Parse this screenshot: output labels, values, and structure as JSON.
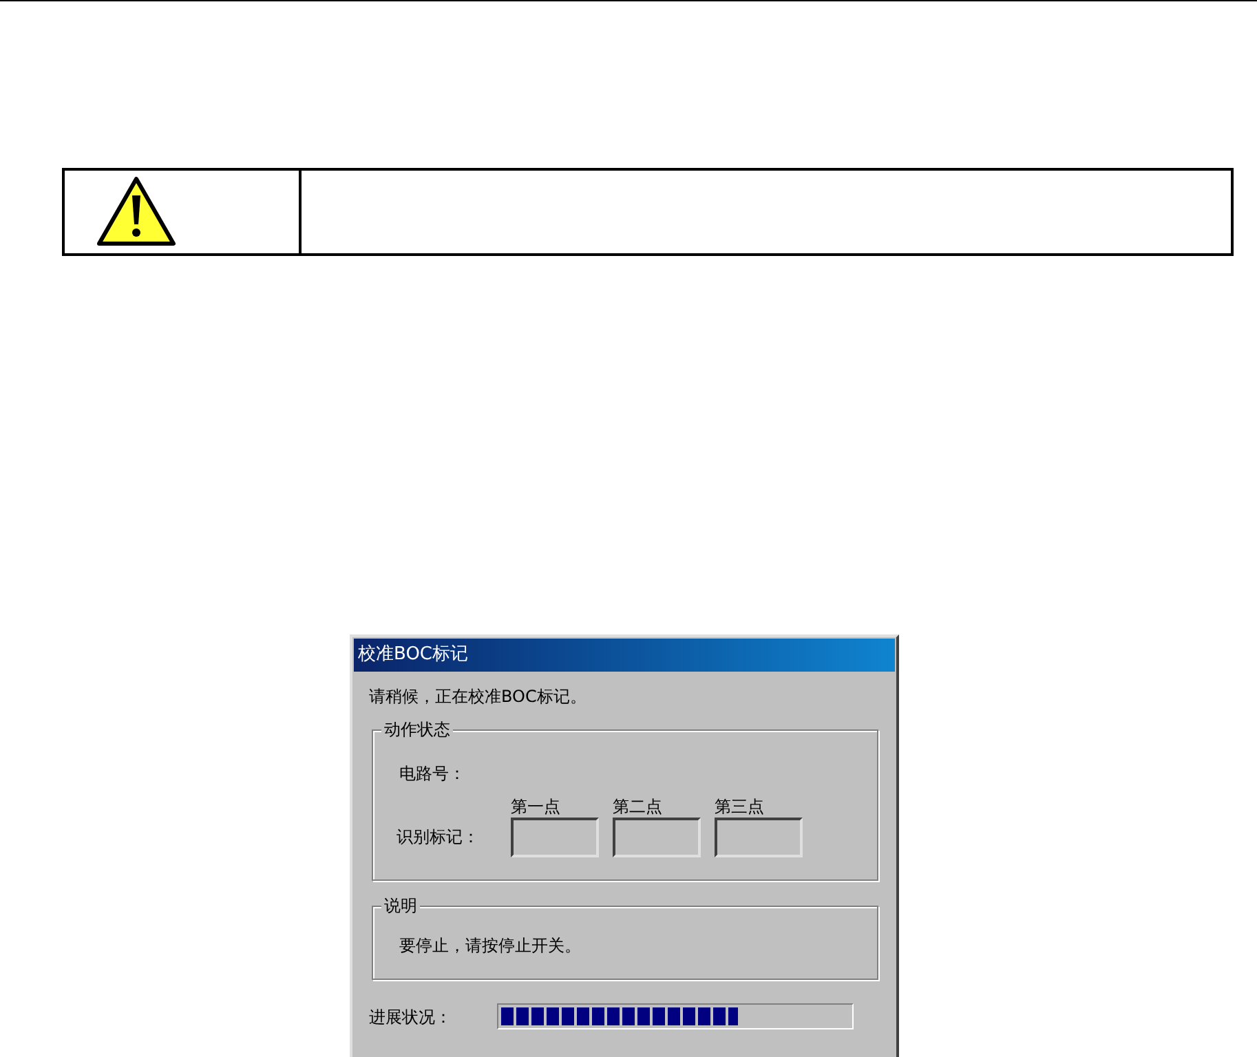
{
  "dialog": {
    "title": "校准BOC标记",
    "message": "请稍候，正在校准BOC标记。",
    "status_group": {
      "title": "动作状态",
      "circuit_label": "电路号：",
      "mark_label": "识别标记：",
      "points": [
        {
          "label": "第一点"
        },
        {
          "label": "第二点"
        },
        {
          "label": "第三点"
        }
      ]
    },
    "note_group": {
      "title": "说明",
      "text": "要停止，请按停止开关。"
    },
    "progress": {
      "label": "进展状况：",
      "level": 0.68
    }
  }
}
